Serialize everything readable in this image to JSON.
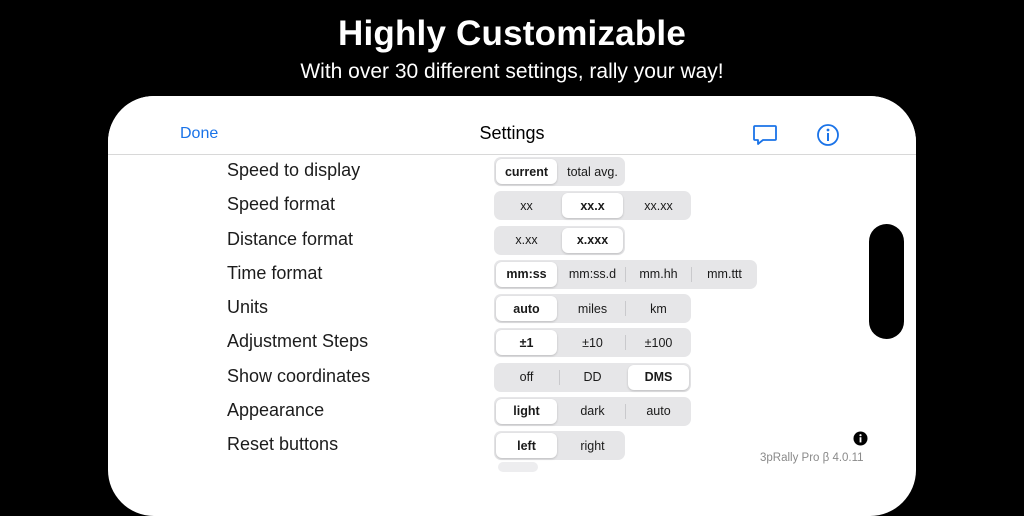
{
  "promo": {
    "title": "Highly Customizable",
    "subtitle": "With over 30 different settings, rally your way!"
  },
  "navbar": {
    "done_label": "Done",
    "title": "Settings",
    "chat_icon": "chat-bubble-icon",
    "info_icon": "info-circle-icon",
    "accent_color": "#1a73e8"
  },
  "settings": [
    {
      "label": "Speed to display",
      "options": [
        "current",
        "total avg."
      ],
      "selected": 0
    },
    {
      "label": "Speed format",
      "options": [
        "xx",
        "xx.x",
        "xx.xx"
      ],
      "selected": 1
    },
    {
      "label": "Distance format",
      "options": [
        "x.xx",
        "x.xxx"
      ],
      "selected": 1
    },
    {
      "label": "Time format",
      "options": [
        "mm:ss",
        "mm:ss.d",
        "mm.hh",
        "mm.ttt"
      ],
      "selected": 0
    },
    {
      "label": "Units",
      "options": [
        "auto",
        "miles",
        "km"
      ],
      "selected": 0
    },
    {
      "label": "Adjustment Steps",
      "options": [
        "±1",
        "±10",
        "±100"
      ],
      "selected": 0
    },
    {
      "label": "Show coordinates",
      "options": [
        "off",
        "DD",
        "DMS"
      ],
      "selected": 2
    },
    {
      "label": "Appearance",
      "options": [
        "light",
        "dark",
        "auto"
      ],
      "selected": 0
    },
    {
      "label": "Reset buttons",
      "options": [
        "left",
        "right"
      ],
      "selected": 0
    }
  ],
  "footer": {
    "version": "3pRally Pro β 4.0.11",
    "info_icon": "info-filled-icon"
  }
}
